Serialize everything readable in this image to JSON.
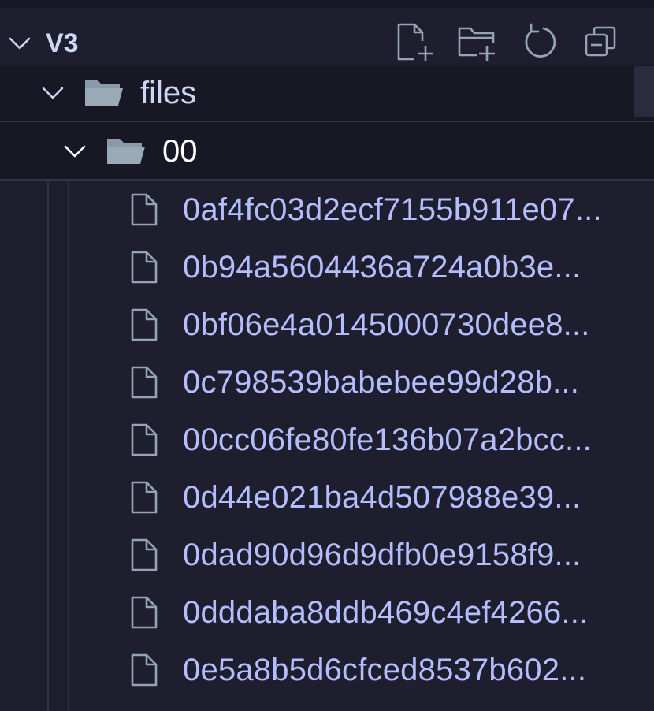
{
  "explorer": {
    "section_title": "V3",
    "actions": [
      {
        "name": "new-file",
        "icon": "new-file-icon"
      },
      {
        "name": "new-folder",
        "icon": "new-folder-icon"
      },
      {
        "name": "refresh",
        "icon": "refresh-icon"
      },
      {
        "name": "collapse-all",
        "icon": "collapse-all-icon"
      }
    ],
    "tree": {
      "folder": {
        "label": "files",
        "expanded": true
      },
      "subfolder": {
        "label": "00",
        "expanded": true
      },
      "files": [
        "0af4fc03d2ecf7155b911e07...",
        "0b94a5604436a724a0b3e...",
        "0bf06e4a0145000730dee8...",
        "0c798539babebee99d28b...",
        "00cc06fe80fe136b07a2bcc...",
        "0d44e021ba4d507988e39...",
        "0dad90d96d9dfb0e9158f9...",
        "0dddaba8ddb469c4ef4266...",
        "0e5a8b5d6cfced8537b602..."
      ]
    },
    "colors": {
      "background": "#1e1e2e",
      "row_background": "#181825",
      "file_text": "#b4befe",
      "folder_text": "#cdd6f4",
      "icon_stroke": "#94a3b8"
    }
  }
}
